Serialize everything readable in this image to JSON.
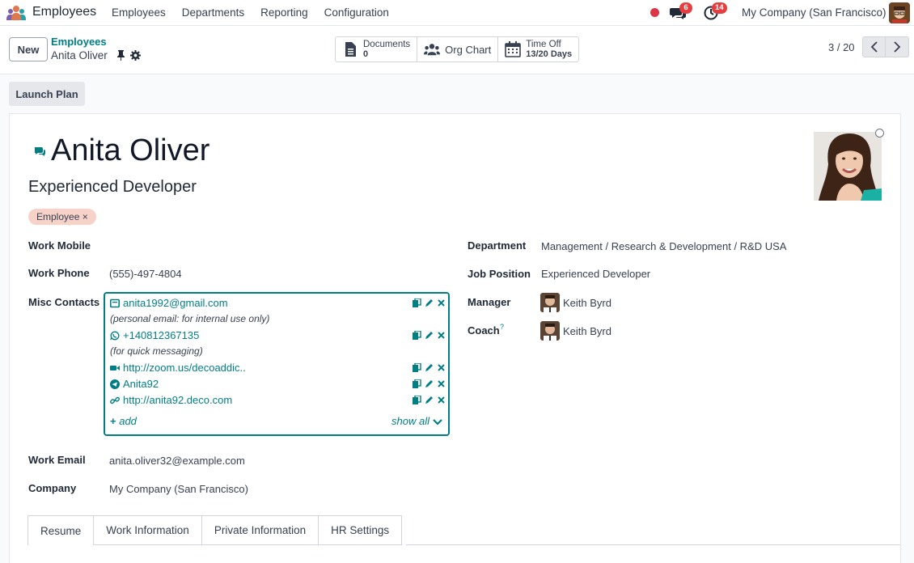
{
  "navbar": {
    "app_name": "Employees",
    "menu": [
      "Employees",
      "Departments",
      "Reporting",
      "Configuration"
    ],
    "chat_badge": "6",
    "activity_badge": "14",
    "company": "My Company (San Francisco)"
  },
  "control": {
    "new_label": "New",
    "breadcrumb_parent": "Employees",
    "breadcrumb_current": "Anita Oliver",
    "smart_buttons": {
      "documents_label": "Documents",
      "documents_value": "0",
      "org_chart_label": "Org Chart",
      "time_off_label": "Time Off",
      "time_off_value": "13/20 Days"
    },
    "pager": "3 / 20"
  },
  "launch_plan_label": "Launch Plan",
  "employee": {
    "name": "Anita Oliver",
    "job_title": "Experienced Developer",
    "tag": "Employee",
    "tag_remove": "×"
  },
  "fields": {
    "work_mobile_label": "Work Mobile",
    "work_phone_label": "Work Phone",
    "work_phone": "(555)-497-4804",
    "misc_contacts_label": "Misc Contacts",
    "work_email_label": "Work Email",
    "work_email": "anita.oliver32@example.com",
    "company_label": "Company",
    "company": "My Company (San Francisco)",
    "department_label": "Department",
    "department": "Management / Research & Development / R&D USA",
    "job_position_label": "Job Position",
    "job_position": "Experienced Developer",
    "manager_label": "Manager",
    "manager": "Keith Byrd",
    "coach_label": "Coach",
    "coach_help": "?",
    "coach": "Keith Byrd"
  },
  "misc_contacts": {
    "email": "anita1992@gmail.com",
    "email_note": "(personal email: for internal use only)",
    "whatsapp": "+140812367135",
    "whatsapp_note": "(for quick messaging)",
    "zoom": "http://zoom.us/decoaddic..",
    "telegram": "Anita92",
    "website": "http://anita92.deco.com",
    "add_label": "add",
    "show_all_label": "show all"
  },
  "tabs": [
    "Resume",
    "Work Information",
    "Private Information",
    "HR Settings"
  ],
  "colors": {
    "accent": "#017e84",
    "badge": "#e53e3e",
    "tag_bg": "#f7d2c9"
  }
}
